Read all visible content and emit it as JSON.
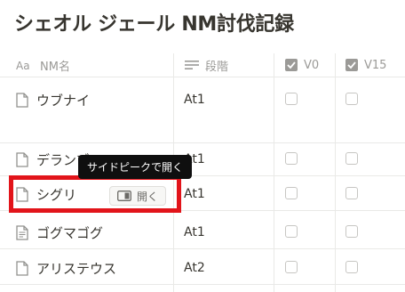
{
  "page": {
    "title": "シェオル ジェール NM討伐記録"
  },
  "columns": [
    {
      "label": "NM名",
      "icon": "text-property-icon"
    },
    {
      "label": "段階",
      "icon": "select-property-icon"
    },
    {
      "label": "V0",
      "icon": "checkbox-property-icon"
    },
    {
      "label": "V15",
      "icon": "checkbox-property-icon"
    }
  ],
  "rows": [
    {
      "name": "ウブナイ",
      "stage": "At1",
      "v0": false,
      "v15": false,
      "icon": "page-icon"
    },
    {
      "name": "デランブ",
      "stage": "At1",
      "v0": false,
      "v15": false,
      "icon": "page-icon"
    },
    {
      "name": "シグリ",
      "stage": "At1",
      "v0": false,
      "v15": false,
      "icon": "page-icon"
    },
    {
      "name": "ゴグマゴグ",
      "stage": "At1",
      "v0": false,
      "v15": false,
      "icon": "page-with-text-icon"
    },
    {
      "name": "アリステウス",
      "stage": "At2",
      "v0": false,
      "v15": false,
      "icon": "page-icon"
    }
  ],
  "hover": {
    "open_button_label": "開く",
    "tooltip": "サイドピークで開く"
  },
  "colors": {
    "highlight": "#e2141a",
    "tooltip_bg": "#0f0f0f",
    "text": "#37352f",
    "muted": "#9b9a97"
  }
}
